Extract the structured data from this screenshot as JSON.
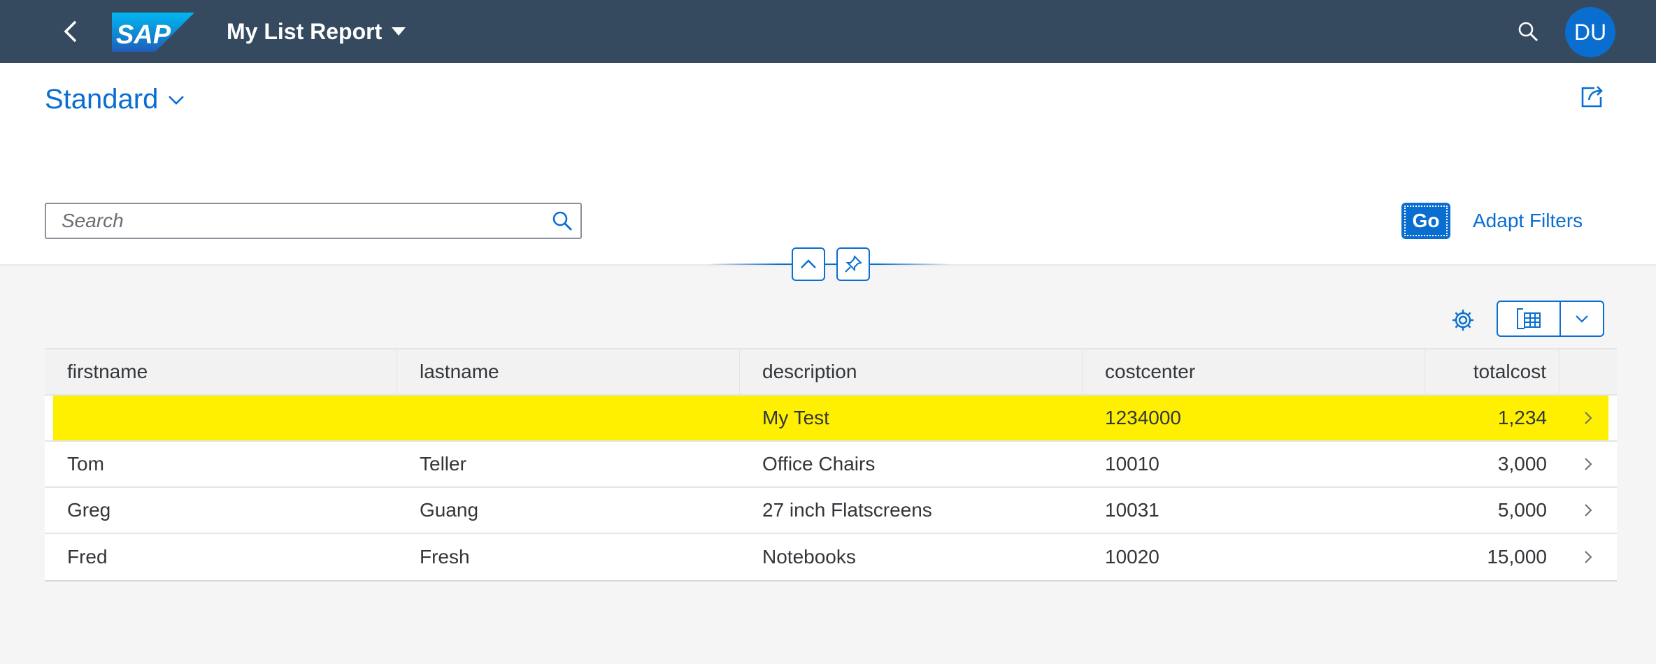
{
  "shell": {
    "brand": "SAP",
    "title": "My List Report",
    "user_initials": "DU",
    "icons": {
      "back": "back-arrow-icon",
      "menu": "caret-down-icon",
      "search": "search-icon"
    }
  },
  "header": {
    "variant": "Standard",
    "search": {
      "placeholder": "Search",
      "value": ""
    },
    "go_label": "Go",
    "adapt_filters_label": "Adapt Filters",
    "icons": {
      "share": "share-icon",
      "collapse": "collapse-header-icon",
      "pin": "pin-icon"
    }
  },
  "toolbar": {
    "icons": {
      "settings": "gear-icon",
      "export": "export-spreadsheet-icon",
      "export_menu": "chevron-down-icon"
    }
  },
  "table": {
    "columns": [
      "firstname",
      "lastname",
      "description",
      "costcenter",
      "totalcost"
    ],
    "rows": [
      {
        "firstname": "",
        "lastname": "",
        "description": "My Test",
        "costcenter": "1234000",
        "totalcost": "1,234",
        "highlighted": true
      },
      {
        "firstname": "Tom",
        "lastname": "Teller",
        "description": "Office Chairs",
        "costcenter": "10010",
        "totalcost": "3,000"
      },
      {
        "firstname": "Greg",
        "lastname": "Guang",
        "description": "27 inch Flatscreens",
        "costcenter": "10031",
        "totalcost": "5,000"
      },
      {
        "firstname": "Fred",
        "lastname": "Fresh",
        "description": "Notebooks",
        "costcenter": "10020",
        "totalcost": "15,000"
      }
    ]
  },
  "colors": {
    "shell_bg": "#354a5f",
    "accent": "#0a6ed1",
    "highlight_row": "#fff000"
  }
}
